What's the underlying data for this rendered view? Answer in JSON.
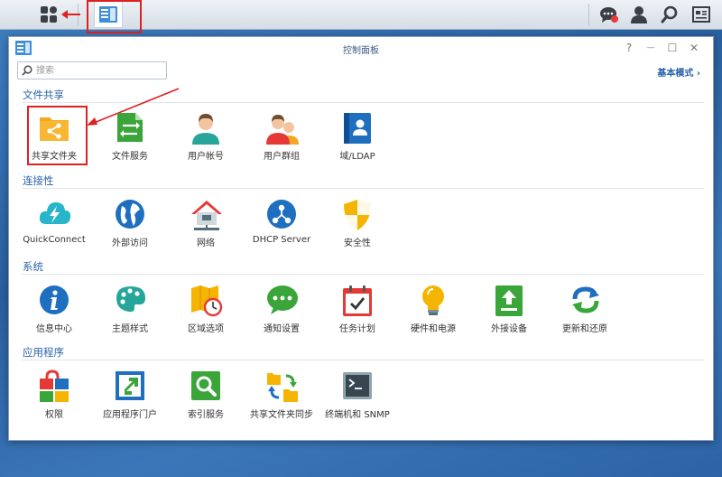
{
  "window": {
    "title": "控制面板",
    "help": "?",
    "minimize": "—",
    "maximize": "☐",
    "close": "✕"
  },
  "search": {
    "placeholder": "搜索",
    "value": ""
  },
  "mode_link": "基本模式 ›",
  "taskbar": {
    "icons": [
      "main-menu-icon",
      "control-panel-icon",
      "chat-icon",
      "user-icon",
      "search-icon",
      "widgets-icon"
    ],
    "notification_color": "#e53935"
  },
  "sections": [
    {
      "title": "文件共享",
      "items": [
        {
          "label": "共享文件夹",
          "icon": "shared-folder-icon"
        },
        {
          "label": "文件服务",
          "icon": "file-services-icon"
        },
        {
          "label": "用户帐号",
          "icon": "user-account-icon"
        },
        {
          "label": "用户群组",
          "icon": "user-group-icon"
        },
        {
          "label": "域/LDAP",
          "icon": "domain-ldap-icon"
        }
      ]
    },
    {
      "title": "连接性",
      "items": [
        {
          "label": "QuickConnect",
          "icon": "quickconnect-icon"
        },
        {
          "label": "外部访问",
          "icon": "external-access-icon"
        },
        {
          "label": "网络",
          "icon": "network-icon"
        },
        {
          "label": "DHCP Server",
          "icon": "dhcp-server-icon"
        },
        {
          "label": "安全性",
          "icon": "security-icon"
        }
      ]
    },
    {
      "title": "系统",
      "items": [
        {
          "label": "信息中心",
          "icon": "info-center-icon"
        },
        {
          "label": "主题样式",
          "icon": "theme-icon"
        },
        {
          "label": "区域选项",
          "icon": "regional-options-icon"
        },
        {
          "label": "通知设置",
          "icon": "notification-icon"
        },
        {
          "label": "任务计划",
          "icon": "task-scheduler-icon"
        },
        {
          "label": "硬件和电源",
          "icon": "hardware-power-icon"
        },
        {
          "label": "外接设备",
          "icon": "external-devices-icon"
        },
        {
          "label": "更新和还原",
          "icon": "update-restore-icon"
        }
      ]
    },
    {
      "title": "应用程序",
      "items": [
        {
          "label": "权限",
          "icon": "privileges-icon"
        },
        {
          "label": "应用程序门户",
          "icon": "application-portal-icon"
        },
        {
          "label": "索引服务",
          "icon": "indexing-service-icon"
        },
        {
          "label": "共享文件夹同步",
          "icon": "shared-folder-sync-icon"
        },
        {
          "label": "终端机和 SNMP",
          "icon": "terminal-snmp-icon"
        }
      ]
    }
  ],
  "annotation_color": "#e02020"
}
